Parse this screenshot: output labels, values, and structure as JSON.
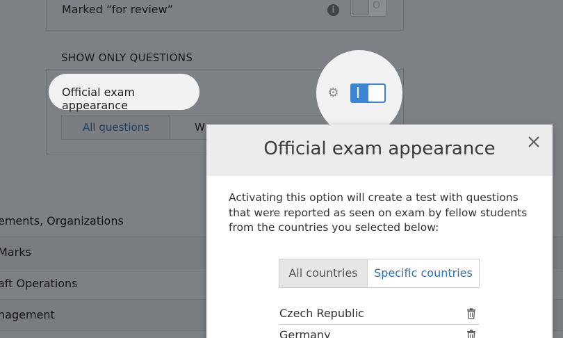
{
  "background": {
    "review_label": "Marked “for review”",
    "review_toggle_state": "O",
    "section_heading": "SHOW ONLY QUESTIONS",
    "filter_label": "Official exam appearance",
    "segments": [
      "All questions",
      "W"
    ],
    "list_items": [
      "ements, Organizations",
      "Marks",
      "aft Operations",
      "nagement"
    ]
  },
  "modal": {
    "title": "Official exam appearance",
    "description": "Activating this option will create a test with questions that were reported as seen on exam by fellow students from the countries you selected below:",
    "tabs": {
      "all": "All countries",
      "specific": "Specific countries",
      "active": "specific"
    },
    "countries": [
      "Czech Republic",
      "Germany"
    ]
  },
  "colors": {
    "accent": "#3d85d6",
    "link": "#2f6fb6",
    "overlay": "#7d8085"
  },
  "icons": {
    "info": "info-icon",
    "gear": "gear-icon",
    "close": "close-icon",
    "trash": "trash-icon"
  }
}
